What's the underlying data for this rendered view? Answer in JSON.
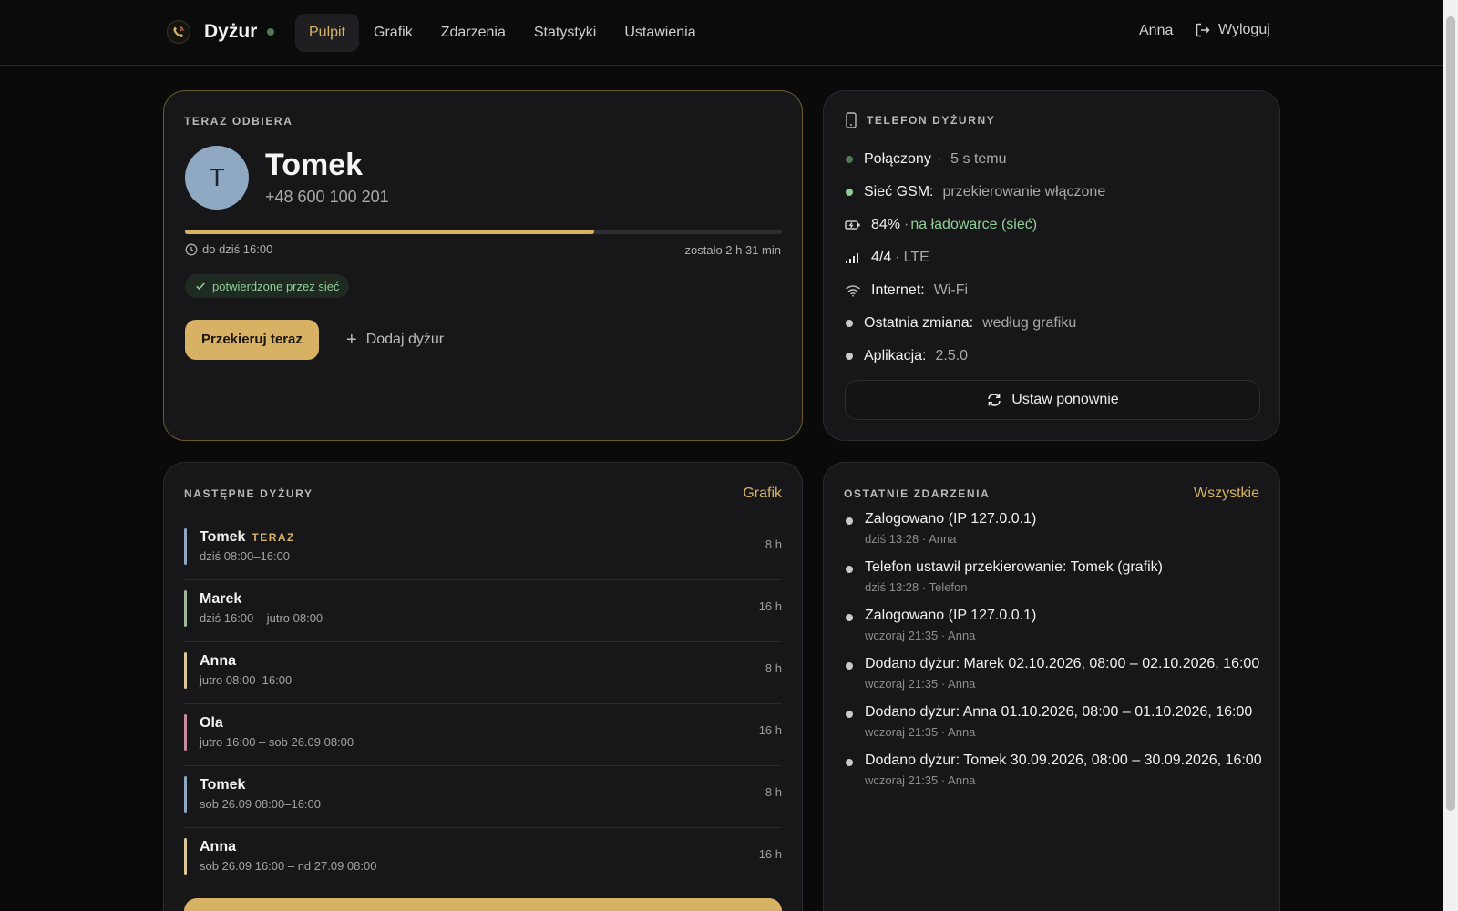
{
  "app": {
    "name": "Dyżur",
    "colors": {
      "accent": "#d8b264",
      "online": "#4e7a55",
      "success": "#8fcf95"
    }
  },
  "nav": {
    "items": [
      {
        "label": "Pulpit",
        "active": true
      },
      {
        "label": "Grafik",
        "active": false
      },
      {
        "label": "Zdarzenia",
        "active": false
      },
      {
        "label": "Statystyki",
        "active": false
      },
      {
        "label": "Ustawienia",
        "active": false
      }
    ],
    "user": "Anna",
    "logout": "Wyloguj"
  },
  "now": {
    "title": "TERAZ ODBIERA",
    "avatar_initial": "T",
    "name": "Tomek",
    "phone": "+48 600 100 201",
    "progress_fraction": 0.685,
    "until": "do dziś 16:00",
    "remaining": "zostało 2 h 31 min",
    "confirmed": "potwierdzone przez sieć",
    "forward_button": "Przekieruj teraz",
    "add_button": "Dodaj dyżur"
  },
  "phone": {
    "title": "TELEFON DYŻURNY",
    "rows": {
      "connected": {
        "label": "Połączony",
        "sep": "·",
        "value": "5 s temu"
      },
      "gsm": {
        "label": "Sieć GSM:",
        "value": "przekierowanie włączone"
      },
      "battery": {
        "label": "84%",
        "sep": "·",
        "value": "na ładowarce (sieć)"
      },
      "signal": {
        "label": "4/4",
        "sep": "·",
        "value": "LTE"
      },
      "internet": {
        "label": "Internet:",
        "value": "Wi-Fi"
      },
      "last_change": {
        "label": "Ostatnia zmiana:",
        "value": "według grafiku"
      },
      "app": {
        "label": "Aplikacja:",
        "value": "2.5.0"
      }
    },
    "reset_button": "Ustaw ponownie"
  },
  "shifts": {
    "title": "NASTĘPNE DYŻURY",
    "link": "Grafik",
    "now_badge": "TERAZ",
    "items": [
      {
        "name": "Tomek",
        "time": "dziś 08:00–16:00",
        "hours": "8 h",
        "color": "#8fa9c3"
      },
      {
        "name": "Marek",
        "time": "dziś 16:00 – jutro 08:00",
        "hours": "16 h",
        "color": "#9fb89a"
      },
      {
        "name": "Anna",
        "time": "jutro 08:00–16:00",
        "hours": "8 h",
        "color": "#e0c79a"
      },
      {
        "name": "Ola",
        "time": "jutro 16:00 – sob 26.09 08:00",
        "hours": "16 h",
        "color": "#c98b9e"
      },
      {
        "name": "Tomek",
        "time": "sob 26.09 08:00–16:00",
        "hours": "8 h",
        "color": "#8fa9c3"
      },
      {
        "name": "Anna",
        "time": "sob 26.09 16:00 – nd 27.09 08:00",
        "hours": "16 h",
        "color": "#e0c79a"
      }
    ]
  },
  "events": {
    "title": "OSTATNIE ZDARZENIA",
    "link": "Wszystkie",
    "items": [
      {
        "title": "Zalogowano (IP 127.0.0.1)",
        "meta": "dziś 13:28 · Anna"
      },
      {
        "title": "Telefon ustawił przekierowanie: Tomek (grafik)",
        "meta": "dziś 13:28 · Telefon"
      },
      {
        "title": "Zalogowano (IP 127.0.0.1)",
        "meta": "wczoraj 21:35 · Anna"
      },
      {
        "title": "Dodano dyżur: Marek 02.10.2026, 08:00 – 02.10.2026, 16:00",
        "meta": "wczoraj 21:35 · Anna"
      },
      {
        "title": "Dodano dyżur: Anna 01.10.2026, 08:00 – 01.10.2026, 16:00",
        "meta": "wczoraj 21:35 · Anna"
      },
      {
        "title": "Dodano dyżur: Tomek 30.09.2026, 08:00 – 30.09.2026, 16:00",
        "meta": "wczoraj 21:35 · Anna"
      }
    ]
  }
}
